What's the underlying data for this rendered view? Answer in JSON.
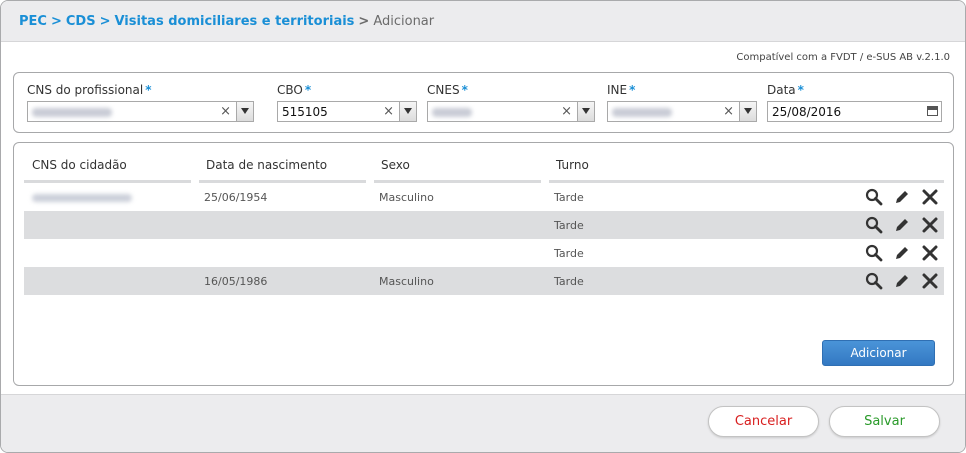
{
  "breadcrumb": {
    "items": [
      "PEC",
      "CDS",
      "Visitas domiciliares e territoriais"
    ],
    "separator": ">",
    "current": "Adicionar"
  },
  "compat_note": "Compatível com a FVDT / e-SUS AB v.2.1.0",
  "form": {
    "cns_label": "CNS do profissional",
    "cbo_label": "CBO",
    "cbo_value": "515105",
    "cnes_label": "CNES",
    "ine_label": "INE",
    "data_label": "Data",
    "data_value": "25/08/2016",
    "required_mark": "*",
    "clear_glyph": "×"
  },
  "table": {
    "headers": [
      "CNS do cidadão",
      "Data de nascimento",
      "Sexo",
      "Turno"
    ],
    "rows": [
      {
        "nascimento": "25/06/1954",
        "sexo": "Masculino",
        "turno": "Tarde"
      },
      {
        "nascimento": "",
        "sexo": "",
        "turno": "Tarde"
      },
      {
        "nascimento": "",
        "sexo": "",
        "turno": "Tarde"
      },
      {
        "nascimento": "16/05/1986",
        "sexo": "Masculino",
        "turno": "Tarde"
      }
    ]
  },
  "buttons": {
    "add": "Adicionar",
    "cancel": "Cancelar",
    "save": "Salvar"
  },
  "icons": {
    "row_actions": [
      "search-icon",
      "pencil-icon",
      "close-icon"
    ],
    "date_picker": "calendar-icon",
    "dropdown": "chevron-down-icon"
  },
  "colors": {
    "link": "#1a8fd6",
    "primary_button": "#3a82cc",
    "cancel": "#d81e1e",
    "save": "#2a9a2a",
    "row_shade": "#dcdddf"
  }
}
